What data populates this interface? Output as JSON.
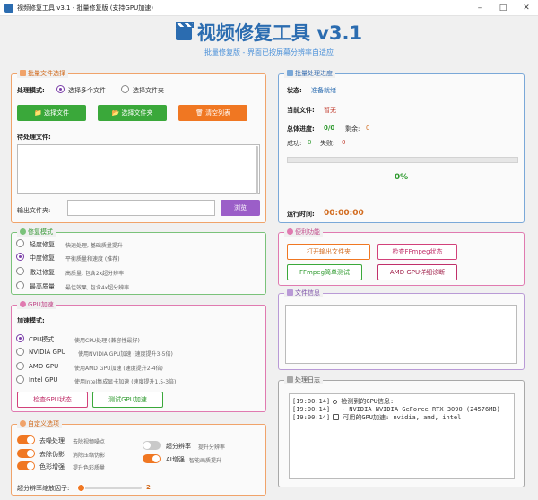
{
  "window": {
    "title": "视频修复工具 v3.1 - 批量修复版 (支持GPU加速)"
  },
  "header": {
    "title": "视频修复工具 v3.1",
    "subtitle": "批量修复版 - 界面已按屏幕分辨率自适应"
  },
  "file_select": {
    "title": "批量文件选择",
    "mode_label": "处理模式:",
    "mode_options": [
      "选择多个文件",
      "选择文件夹"
    ],
    "selected_mode": "选择多个文件",
    "btn_select_files": "选择文件",
    "btn_select_folder": "选择文件夹",
    "btn_clear": "清空列表",
    "pending_label": "待处理文件:",
    "output_label": "输出文件夹:",
    "output_value": "",
    "btn_browse": "浏览"
  },
  "progress": {
    "title": "批量处理进度",
    "status_label": "状态:",
    "status_value": "准备就绪",
    "current_file_label": "当前文件:",
    "current_file_value": "暂无",
    "total_label": "总体进度:",
    "total_value": "0/0",
    "remaining_label": "剩余:",
    "remaining_value": "0",
    "success_label": "成功:",
    "success_value": "0",
    "fail_label": "失败:",
    "fail_value": "0",
    "percent": "0%",
    "progress_fraction": 0,
    "time_label": "运行时间:",
    "time_value": "00:00:00"
  },
  "repair_mode": {
    "title": "修复模式",
    "options": [
      {
        "label": "轻度修复",
        "desc": "快速处理, 基础质量提升"
      },
      {
        "label": "中度修复",
        "desc": "平衡质量和速度 (推荐)"
      },
      {
        "label": "激进修复",
        "desc": "高质量, 包含2x超分辨率"
      },
      {
        "label": "最高质量",
        "desc": "最佳效果, 包含4x超分辨率"
      }
    ],
    "selected": "中度修复"
  },
  "utilities": {
    "title": "便利功能",
    "btn_open_output": "打开输出文件夹",
    "btn_check_ffmpeg": "检查FFmpeg状态",
    "btn_ffmpeg_test": "FFmpeg简单测试",
    "btn_amd_diag": "AMD GPU详细诊断"
  },
  "file_info": {
    "title": "文件信息"
  },
  "gpu": {
    "title": "GPU加速",
    "mode_label": "加速模式:",
    "options": [
      {
        "label": "CPU模式",
        "desc": "使用CPU处理 (兼容性最好)"
      },
      {
        "label": "NVIDIA GPU",
        "desc": "使用NVIDIA GPU加速 (速度提升3-5倍)"
      },
      {
        "label": "AMD GPU",
        "desc": "使用AMD GPU加速 (速度提升2-4倍)"
      },
      {
        "label": "Intel GPU",
        "desc": "使用Intel集成显卡加速 (速度提升1.5-3倍)"
      }
    ],
    "selected": "CPU模式",
    "btn_check": "检查GPU状态",
    "btn_test": "测试GPU加速"
  },
  "log": {
    "title": "处理日志",
    "lines": [
      {
        "time": "[19:00:14]",
        "icon": "magnifier-icon",
        "text": "检测到的GPU信息:"
      },
      {
        "time": "[19:00:14]",
        "icon": "",
        "text": "- NVIDIA NVIDIA GeForce RTX 3090 (24576MB)"
      },
      {
        "time": "[19:00:14]",
        "icon": "check-box-icon",
        "text": "可用的GPU加速: nvidia, amd, intel"
      }
    ]
  },
  "custom": {
    "title": "自定义选项",
    "toggles": [
      {
        "label": "去噪处理",
        "desc": "去除视频噪点",
        "on": true
      },
      {
        "label": "去除伪影",
        "desc": "消除压缩伪影",
        "on": true
      },
      {
        "label": "色彩增强",
        "desc": "提升色彩质量",
        "on": true
      },
      {
        "label": "超分辨率",
        "desc": "提升分辨率",
        "on": false
      },
      {
        "label": "AI增强",
        "desc": "智能画质提升",
        "on": true
      }
    ],
    "scale_label": "超分辨率缩放因子:",
    "scale_value": "2",
    "scale_min": 2,
    "scale_max": 4
  },
  "colors": {
    "accent_blue": "#2b6cb0",
    "green": "#3aa83a",
    "orange": "#f07722",
    "purple": "#9b5ec8",
    "pink": "#d2417a"
  }
}
